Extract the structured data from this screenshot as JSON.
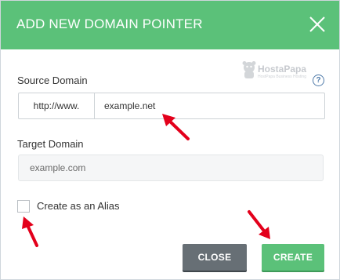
{
  "dialog": {
    "title": "ADD NEW DOMAIN POINTER",
    "logo_text": "HostaPapa",
    "logo_tagline": "HostPapa Business Hosting"
  },
  "source_domain": {
    "label": "Source Domain",
    "prefix": "http://www.",
    "value": "example.net"
  },
  "target_domain": {
    "label": "Target Domain",
    "placeholder": "example.com"
  },
  "alias": {
    "label": "Create as an Alias",
    "checked": false
  },
  "buttons": {
    "close_label": "CLOSE",
    "create_label": "CREATE"
  },
  "colors": {
    "header": "#5bc179",
    "create_button": "#5bc179",
    "close_button": "#676f75",
    "annotation_arrow": "#e3001b",
    "help_icon": "#4f7aa9"
  },
  "icons": {
    "close": "close-icon",
    "help": "help-icon",
    "logo": "hostpapa-logo"
  }
}
